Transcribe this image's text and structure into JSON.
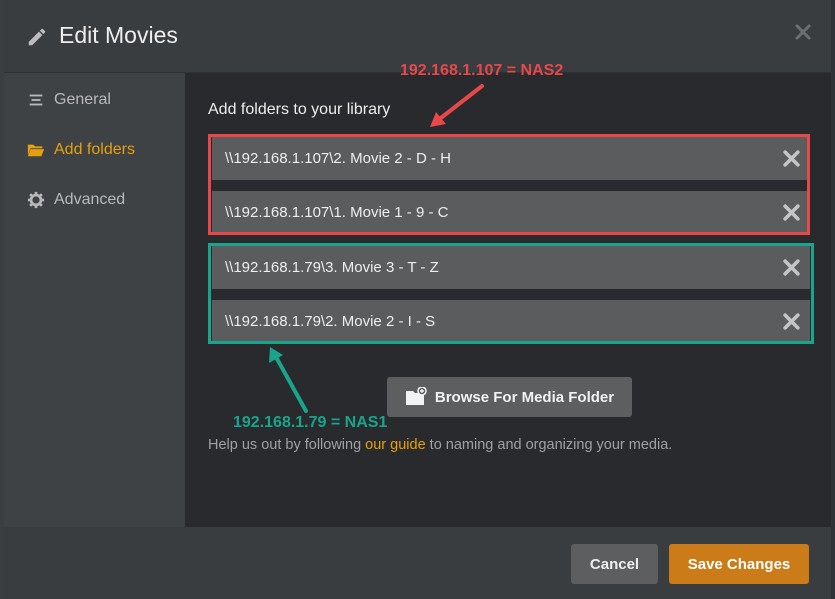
{
  "dialog": {
    "title": "Edit Movies"
  },
  "sidebar": {
    "items": [
      {
        "label": "General",
        "icon": "list-icon",
        "active": false
      },
      {
        "label": "Add folders",
        "icon": "folder-open-icon",
        "active": true
      },
      {
        "label": "Advanced",
        "icon": "gear-icon",
        "active": false
      }
    ]
  },
  "main": {
    "heading": "Add folders to your library",
    "folders": [
      "\\\\192.168.1.107\\2. Movie 2 - D - H",
      "\\\\192.168.1.107\\1. Movie 1 - 9 - C",
      "\\\\192.168.1.79\\3. Movie 3 - T - Z",
      "\\\\192.168.1.79\\2. Movie 2 - I - S"
    ],
    "browse_label": "Browse For Media Folder",
    "help": {
      "prefix": "Help us out by following ",
      "link": "our guide",
      "suffix": " to naming and organizing your media."
    }
  },
  "annotations": {
    "nas2": "192.168.1.107 = NAS2",
    "nas1": "192.168.1.79 = NAS1"
  },
  "footer": {
    "cancel_label": "Cancel",
    "save_label": "Save Changes"
  },
  "colors": {
    "accent": "#e5a00d",
    "save": "#cc7b19",
    "annot_red": "#e8484a",
    "annot_teal": "#18a58b"
  }
}
